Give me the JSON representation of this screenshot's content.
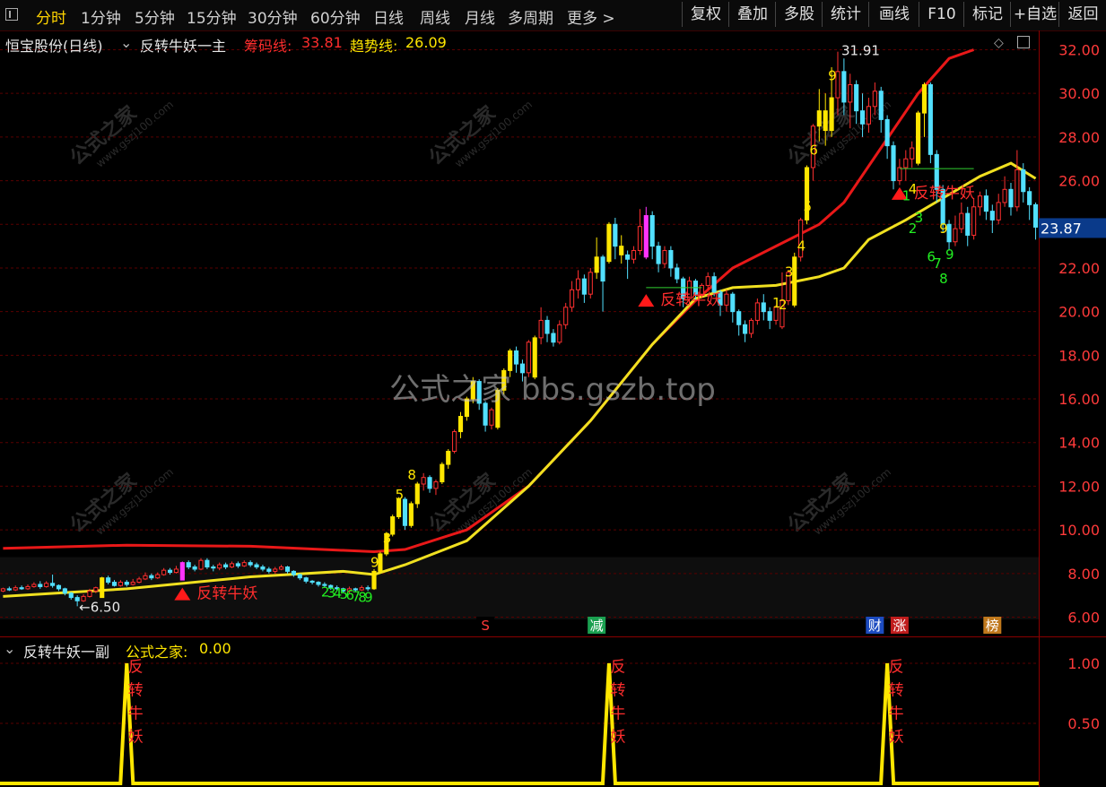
{
  "toolbar": {
    "periods": [
      "分时",
      "1分钟",
      "5分钟",
      "15分钟",
      "30分钟",
      "60分钟",
      "日线",
      "周线",
      "月线",
      "多周期",
      "更多 >"
    ],
    "active_index": 0,
    "right_buttons": [
      "复权",
      "叠加",
      "多股",
      "统计",
      "画线",
      "F10",
      "标记",
      "+自选",
      "返回"
    ]
  },
  "main_header": {
    "stock": "恒宝股份(日线)",
    "indicator": "反转牛妖一主",
    "chip_label": "筹码线:",
    "chip_value": "33.81",
    "trend_label": "趋势线:",
    "trend_value": "26.09"
  },
  "sub_header": {
    "indicator": "反转牛妖一副",
    "label": "公式之家:",
    "value": "0.00"
  },
  "colors": {
    "up": "#ff3030",
    "down": "#52e0ff",
    "signal": "#ffe600",
    "chip_line": "#e81818",
    "trend_line": "#f0e020",
    "magenta": "#ff33ff"
  },
  "watermarks": {
    "center": "公式之家 bbs.gszb.top",
    "tile_main": "公式之家",
    "tile_sub": "www.gszj100.com"
  },
  "price_marks": {
    "low": "←6.50",
    "high": "31.91"
  },
  "last_price_tag": "23.87",
  "event_markers": [
    "S",
    "减",
    "财",
    "涨",
    "榜"
  ],
  "signal_label": "反转牛妖",
  "chart_data": [
    {
      "type": "candlestick",
      "title": "恒宝股份(日线) 反转牛妖一主",
      "y_axis": {
        "min": 5.2,
        "max": 32.8,
        "ticks": [
          32.0,
          30.0,
          28.0,
          26.0,
          24.0,
          22.0,
          20.0,
          18.0,
          16.0,
          14.0,
          12.0,
          10.0,
          8.0,
          6.0
        ]
      },
      "candles": [
        [
          7.2,
          7.3,
          7.15,
          7.35
        ],
        [
          7.3,
          7.25,
          7.2,
          7.4
        ],
        [
          7.25,
          7.35,
          7.2,
          7.45
        ],
        [
          7.35,
          7.3,
          7.25,
          7.45
        ],
        [
          7.3,
          7.4,
          7.25,
          7.5
        ],
        [
          7.4,
          7.5,
          7.35,
          7.6
        ],
        [
          7.5,
          7.4,
          7.3,
          7.65
        ],
        [
          7.4,
          7.55,
          7.35,
          7.65
        ],
        [
          7.55,
          7.45,
          7.35,
          7.95
        ],
        [
          7.45,
          7.3,
          7.2,
          7.5
        ],
        [
          7.3,
          7.1,
          7.0,
          7.35
        ],
        [
          7.1,
          6.9,
          6.8,
          7.15
        ],
        [
          6.9,
          6.75,
          6.5,
          7.0
        ],
        [
          6.75,
          6.95,
          6.7,
          7.05
        ],
        [
          6.95,
          7.2,
          6.9,
          7.3
        ],
        [
          7.2,
          7.35,
          7.1,
          7.4
        ],
        [
          6.9,
          7.8,
          6.9,
          7.85
        ],
        [
          7.8,
          7.6,
          7.5,
          7.9
        ],
        [
          7.6,
          7.45,
          7.4,
          7.7
        ],
        [
          7.45,
          7.6,
          7.4,
          7.7
        ],
        [
          7.6,
          7.5,
          7.4,
          7.7
        ],
        [
          7.5,
          7.6,
          7.45,
          7.75
        ],
        [
          7.6,
          7.75,
          7.55,
          7.85
        ],
        [
          7.75,
          7.9,
          7.7,
          8.05
        ],
        [
          7.9,
          7.8,
          7.7,
          8.0
        ],
        [
          7.8,
          7.95,
          7.75,
          8.05
        ],
        [
          7.95,
          8.15,
          7.9,
          8.25
        ],
        [
          8.15,
          8.05,
          7.95,
          8.25
        ],
        [
          8.05,
          8.2,
          8.0,
          8.35
        ],
        [
          7.7,
          8.5,
          7.7,
          8.55
        ],
        [
          8.5,
          8.3,
          8.2,
          8.6
        ],
        [
          8.3,
          8.2,
          8.1,
          8.4
        ],
        [
          8.2,
          8.6,
          8.15,
          8.7
        ],
        [
          8.6,
          8.3,
          8.2,
          8.7
        ],
        [
          8.3,
          8.25,
          8.1,
          8.4
        ],
        [
          8.25,
          8.4,
          8.15,
          8.5
        ],
        [
          8.4,
          8.3,
          8.2,
          8.5
        ],
        [
          8.3,
          8.45,
          8.25,
          8.55
        ],
        [
          8.45,
          8.35,
          8.25,
          8.55
        ],
        [
          8.35,
          8.5,
          8.3,
          8.6
        ],
        [
          8.5,
          8.4,
          8.3,
          8.6
        ],
        [
          8.4,
          8.3,
          8.2,
          8.5
        ],
        [
          8.3,
          8.2,
          8.1,
          8.4
        ],
        [
          8.2,
          8.1,
          8.0,
          8.3
        ],
        [
          8.1,
          8.2,
          8.0,
          8.3
        ],
        [
          8.2,
          8.3,
          8.15,
          8.4
        ],
        [
          8.3,
          8.1,
          8.0,
          8.35
        ],
        [
          8.1,
          7.95,
          7.85,
          8.15
        ],
        [
          7.95,
          7.8,
          7.7,
          8.0
        ],
        [
          7.8,
          7.65,
          7.55,
          7.85
        ],
        [
          7.65,
          7.6,
          7.5,
          7.7
        ],
        [
          7.6,
          7.5,
          7.4,
          7.65
        ],
        [
          7.5,
          7.45,
          7.35,
          7.6
        ],
        [
          7.45,
          7.35,
          7.25,
          7.5
        ],
        [
          7.35,
          7.3,
          7.2,
          7.45
        ],
        [
          7.3,
          7.2,
          7.1,
          7.35
        ],
        [
          7.2,
          7.3,
          7.1,
          7.4
        ],
        [
          7.3,
          7.25,
          7.15,
          7.35
        ],
        [
          7.25,
          7.35,
          7.2,
          7.45
        ],
        [
          7.35,
          7.3,
          7.2,
          7.45
        ],
        [
          7.3,
          8.1,
          7.25,
          8.2
        ],
        [
          8.1,
          8.9,
          8.0,
          9.0
        ],
        [
          8.9,
          9.8,
          8.8,
          9.9
        ],
        [
          9.8,
          10.6,
          9.7,
          10.7
        ],
        [
          10.6,
          11.4,
          10.5,
          11.5
        ],
        [
          11.4,
          10.2,
          10.0,
          11.5
        ],
        [
          10.2,
          11.2,
          10.1,
          11.3
        ],
        [
          11.2,
          12.1,
          11.0,
          12.2
        ],
        [
          12.1,
          12.4,
          11.8,
          12.6
        ],
        [
          12.4,
          11.9,
          11.7,
          12.5
        ],
        [
          11.9,
          12.2,
          11.6,
          12.3
        ],
        [
          12.2,
          13.0,
          12.1,
          13.1
        ],
        [
          13.0,
          13.6,
          12.8,
          13.7
        ],
        [
          13.6,
          14.5,
          13.5,
          14.6
        ],
        [
          14.5,
          15.2,
          14.2,
          15.4
        ],
        [
          15.2,
          16.0,
          15.0,
          16.1
        ],
        [
          16.0,
          16.8,
          15.8,
          17.0
        ],
        [
          16.8,
          15.8,
          15.5,
          16.9
        ],
        [
          15.8,
          14.8,
          14.5,
          15.9
        ],
        [
          14.8,
          15.5,
          14.6,
          15.6
        ],
        [
          14.7,
          16.4,
          14.6,
          16.5
        ],
        [
          16.4,
          17.3,
          16.2,
          17.4
        ],
        [
          17.3,
          18.2,
          17.0,
          18.3
        ],
        [
          18.2,
          17.6,
          17.2,
          18.4
        ],
        [
          17.6,
          17.2,
          16.8,
          17.8
        ],
        [
          17.2,
          18.6,
          17.0,
          18.7
        ],
        [
          17.0,
          18.8,
          16.9,
          18.9
        ],
        [
          18.8,
          19.6,
          18.5,
          20.2
        ],
        [
          19.6,
          19.0,
          18.6,
          19.8
        ],
        [
          19.0,
          18.6,
          18.4,
          19.2
        ],
        [
          18.6,
          19.4,
          18.5,
          19.6
        ],
        [
          19.4,
          20.2,
          19.2,
          20.4
        ],
        [
          20.2,
          21.0,
          20.0,
          21.4
        ],
        [
          21.0,
          21.5,
          20.6,
          21.9
        ],
        [
          21.5,
          20.8,
          20.4,
          21.7
        ],
        [
          20.8,
          21.8,
          20.6,
          22.0
        ],
        [
          21.8,
          22.5,
          21.5,
          23.4
        ],
        [
          22.5,
          21.4,
          20.0,
          22.6
        ],
        [
          22.3,
          24.0,
          22.2,
          24.1
        ],
        [
          24.0,
          23.0,
          22.4,
          24.3
        ],
        [
          23.0,
          22.6,
          22.2,
          23.5
        ],
        [
          22.6,
          22.4,
          21.5,
          22.8
        ],
        [
          22.4,
          22.8,
          22.2,
          23.0
        ],
        [
          22.8,
          23.9,
          22.6,
          24.7
        ],
        [
          22.5,
          24.4,
          22.4,
          24.8
        ],
        [
          24.4,
          23.0,
          22.4,
          24.6
        ],
        [
          23.0,
          22.2,
          21.8,
          23.2
        ],
        [
          22.2,
          22.8,
          22.0,
          23.0
        ],
        [
          22.8,
          22.0,
          21.6,
          23.0
        ],
        [
          22.0,
          21.5,
          21.3,
          22.2
        ],
        [
          21.5,
          20.6,
          20.2,
          21.6
        ],
        [
          20.6,
          21.4,
          20.3,
          21.6
        ],
        [
          21.4,
          20.8,
          20.5,
          21.5
        ],
        [
          20.8,
          21.2,
          20.6,
          21.3
        ],
        [
          21.2,
          21.6,
          21.0,
          21.8
        ],
        [
          21.6,
          20.9,
          20.7,
          21.8
        ],
        [
          20.9,
          20.3,
          19.8,
          21.0
        ],
        [
          20.3,
          20.8,
          20.0,
          21.0
        ],
        [
          20.8,
          20.0,
          19.5,
          20.9
        ],
        [
          20.0,
          19.4,
          18.9,
          20.1
        ],
        [
          19.4,
          19.0,
          18.6,
          19.6
        ],
        [
          19.0,
          19.6,
          18.8,
          19.7
        ],
        [
          19.6,
          20.4,
          19.4,
          20.6
        ],
        [
          20.4,
          20.0,
          19.6,
          20.8
        ],
        [
          20.0,
          19.6,
          19.2,
          20.2
        ],
        [
          19.6,
          20.2,
          19.4,
          20.3
        ],
        [
          19.3,
          20.5,
          19.2,
          21.8
        ],
        [
          20.5,
          21.8,
          20.3,
          21.9
        ],
        [
          20.3,
          22.5,
          20.2,
          22.7
        ],
        [
          22.5,
          24.2,
          22.3,
          24.3
        ],
        [
          24.2,
          26.6,
          24.0,
          26.7
        ],
        [
          26.6,
          28.5,
          26.0,
          28.6
        ],
        [
          28.5,
          29.2,
          27.8,
          30.2
        ],
        [
          29.2,
          28.3,
          27.6,
          30.0
        ],
        [
          28.3,
          29.8,
          28.0,
          31.2
        ],
        [
          29.8,
          31.0,
          29.0,
          31.91
        ],
        [
          31.0,
          29.6,
          29.0,
          31.6
        ],
        [
          29.6,
          30.4,
          28.4,
          30.9
        ],
        [
          30.4,
          29.2,
          28.6,
          30.6
        ],
        [
          29.2,
          28.6,
          28.0,
          30.0
        ],
        [
          28.6,
          29.4,
          28.2,
          29.8
        ],
        [
          29.4,
          30.1,
          29.0,
          30.5
        ],
        [
          30.1,
          28.8,
          28.2,
          30.3
        ],
        [
          28.8,
          27.6,
          27.0,
          29.0
        ],
        [
          27.6,
          26.0,
          25.6,
          27.8
        ],
        [
          26.0,
          26.6,
          25.8,
          27.0
        ],
        [
          26.6,
          27.0,
          26.0,
          27.4
        ],
        [
          27.0,
          27.5,
          26.6,
          27.8
        ],
        [
          26.8,
          29.1,
          26.7,
          29.2
        ],
        [
          29.1,
          30.4,
          28.0,
          30.5
        ],
        [
          30.4,
          27.2,
          26.8,
          30.5
        ],
        [
          27.2,
          25.6,
          25.0,
          27.4
        ],
        [
          25.6,
          24.0,
          23.6,
          25.8
        ],
        [
          24.0,
          23.2,
          22.8,
          24.2
        ],
        [
          23.2,
          23.8,
          23.0,
          24.4
        ],
        [
          23.8,
          24.5,
          23.6,
          25.0
        ],
        [
          24.5,
          23.5,
          23.0,
          24.8
        ],
        [
          23.5,
          24.8,
          23.3,
          25.2
        ],
        [
          24.8,
          25.3,
          24.4,
          25.5
        ],
        [
          25.3,
          24.6,
          24.2,
          25.6
        ],
        [
          24.6,
          24.2,
          23.6,
          24.9
        ],
        [
          24.2,
          25.0,
          24.0,
          25.4
        ],
        [
          25.0,
          25.6,
          24.8,
          26.2
        ],
        [
          25.6,
          24.8,
          24.4,
          25.9
        ],
        [
          24.8,
          26.5,
          24.6,
          27.4
        ],
        [
          26.5,
          25.5,
          25.0,
          26.8
        ],
        [
          25.5,
          24.9,
          24.2,
          25.7
        ],
        [
          24.9,
          23.87,
          23.3,
          25.0
        ]
      ],
      "chip_line": [
        [
          0,
          9.15
        ],
        [
          20,
          9.3
        ],
        [
          40,
          9.25
        ],
        [
          60,
          9.0
        ],
        [
          65,
          9.1
        ],
        [
          75,
          10.0
        ],
        [
          85,
          12.0
        ],
        [
          95,
          15.0
        ],
        [
          105,
          18.5
        ],
        [
          112,
          20.5
        ],
        [
          118,
          22.0
        ],
        [
          125,
          23.0
        ],
        [
          132,
          24.0
        ],
        [
          136,
          25.0
        ],
        [
          142,
          27.5
        ],
        [
          148,
          30.0
        ],
        [
          153,
          31.6
        ],
        [
          157,
          32.0
        ]
      ],
      "trend_line": [
        [
          0,
          6.95
        ],
        [
          20,
          7.3
        ],
        [
          40,
          7.85
        ],
        [
          55,
          8.1
        ],
        [
          60,
          7.95
        ],
        [
          65,
          8.4
        ],
        [
          75,
          9.5
        ],
        [
          85,
          12.0
        ],
        [
          95,
          15.0
        ],
        [
          105,
          18.5
        ],
        [
          112,
          20.6
        ],
        [
          118,
          21.1
        ],
        [
          125,
          21.2
        ],
        [
          132,
          21.6
        ],
        [
          136,
          22.0
        ],
        [
          140,
          23.3
        ],
        [
          146,
          24.2
        ],
        [
          152,
          25.2
        ],
        [
          158,
          26.2
        ],
        [
          163,
          26.8
        ],
        [
          167,
          26.1
        ]
      ]
    },
    {
      "type": "line",
      "title": "反转牛妖一副",
      "y_axis": {
        "min": 0,
        "max": 1.0,
        "ticks": [
          1.0,
          0.5
        ]
      },
      "spikes_at_index": [
        20,
        98,
        143
      ],
      "baseline": 0
    }
  ]
}
